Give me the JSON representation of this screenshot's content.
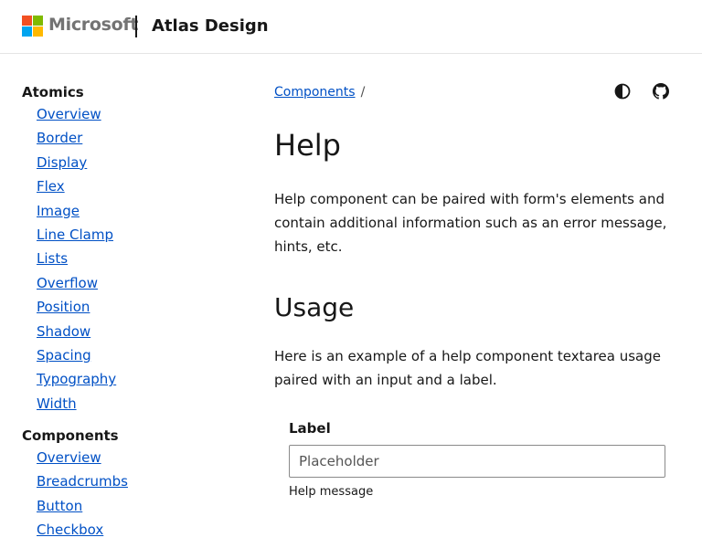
{
  "header": {
    "brand": "Microsoft",
    "site_title": "Atlas Design",
    "logo_colors": [
      "#f25022",
      "#7fba00",
      "#00a4ef",
      "#ffb900"
    ]
  },
  "sidebar": {
    "groups": [
      {
        "title": "Atomics",
        "items": [
          "Overview",
          "Border",
          "Display",
          "Flex",
          "Image",
          "Line Clamp",
          "Lists",
          "Overflow",
          "Position",
          "Shadow",
          "Spacing",
          "Typography",
          "Width"
        ]
      },
      {
        "title": "Components",
        "items": [
          "Overview",
          "Breadcrumbs",
          "Button",
          "Checkbox"
        ]
      }
    ]
  },
  "breadcrumb": {
    "link": "Components",
    "separator": "/"
  },
  "toolbar": {
    "icons": [
      "theme-toggle-icon",
      "github-icon"
    ]
  },
  "main": {
    "title": "Help",
    "intro": "Help component can be paired with form's elements and contain additional information such as an error message, hints, etc.",
    "usage_title": "Usage",
    "usage_text": "Here is an example of a help component textarea usage paired with an input and a label."
  },
  "form": {
    "label": "Label",
    "placeholder": "Placeholder",
    "value": "",
    "help": "Help message"
  },
  "colors": {
    "link": "#0050c5",
    "text": "#171717"
  }
}
